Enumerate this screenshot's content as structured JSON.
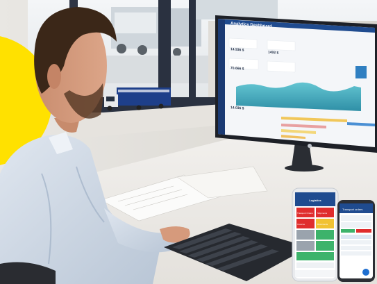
{
  "dashboard": {
    "title": "Analytics Dashboard",
    "kpi_values": [
      "14.936 $",
      "1492 $",
      "70.666 $",
      "14.036 $"
    ]
  },
  "phone_app": {
    "title": "Logistics",
    "tiles": [
      "Transport Orders",
      "Shipments",
      "Invoices",
      "Documents"
    ]
  },
  "phone_detail": {
    "title": "Transport orders"
  }
}
